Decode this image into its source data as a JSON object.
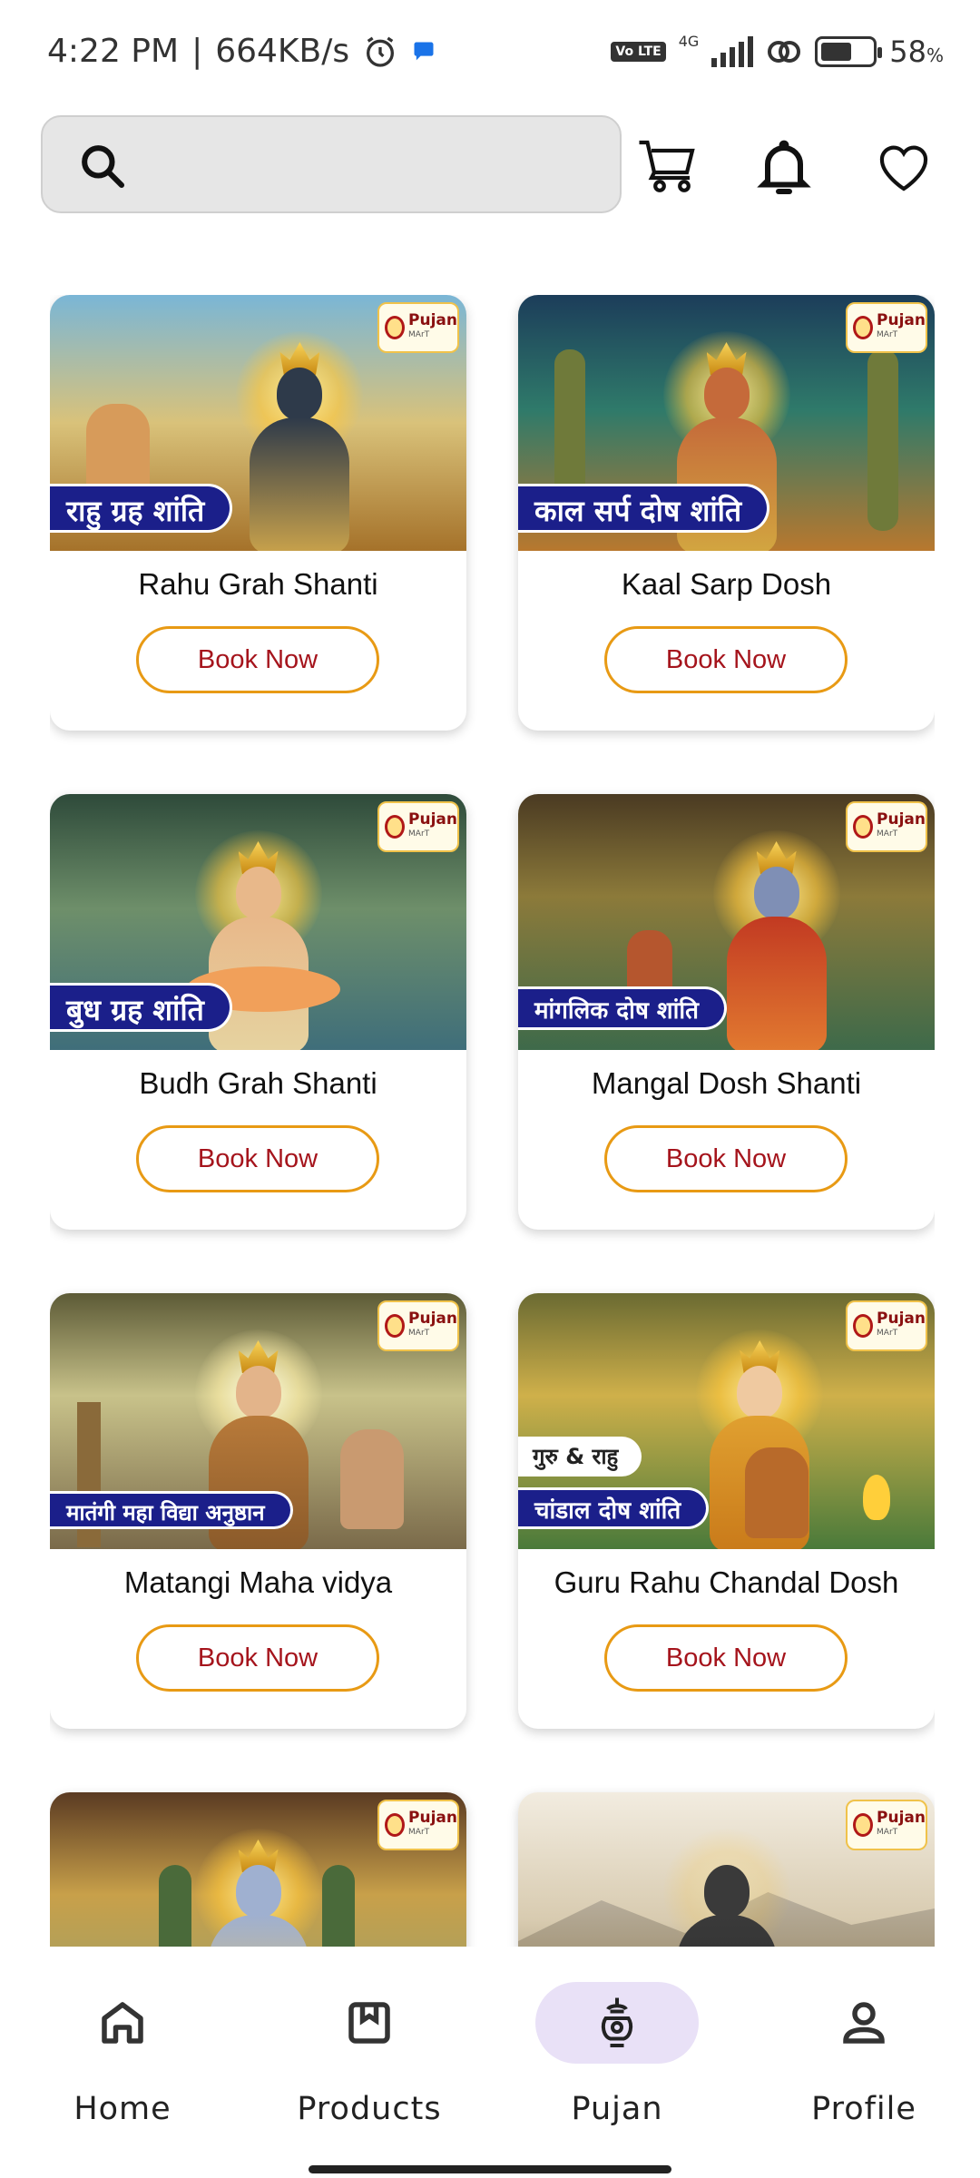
{
  "status_bar": {
    "time": "4:22 PM",
    "separator": "|",
    "speed": "664KB/s",
    "network": "4G",
    "volte": "Vo LTE",
    "battery": "58",
    "battery_unit": "%",
    "battery_level": 0.58
  },
  "header": {
    "search_placeholder": "",
    "cart_icon": "cart-icon",
    "bell_icon": "bell-icon",
    "heart_icon": "heart-icon"
  },
  "logo": {
    "name": "Pujan",
    "tag": "MArT"
  },
  "book_label": "Book Now",
  "cards": [
    {
      "title": "Rahu Grah Shanti",
      "banner": "राहु ग्रह शांति",
      "sub_banner": ""
    },
    {
      "title": "Kaal Sarp Dosh",
      "banner": "काल सर्प दोष शांति",
      "sub_banner": ""
    },
    {
      "title": "Budh Grah Shanti",
      "banner": "बुध ग्रह शांति",
      "sub_banner": ""
    },
    {
      "title": "Mangal Dosh Shanti",
      "banner": "मांगलिक दोष शांति",
      "sub_banner": ""
    },
    {
      "title": "Matangi Maha vidya",
      "banner": "मातंगी महा विद्या अनुष्ठान",
      "sub_banner": ""
    },
    {
      "title": "Guru Rahu Chandal Dosh",
      "banner": "चांडाल दोष शांति",
      "sub_banner": "गुरु & राहु"
    },
    {
      "title": "",
      "banner": "",
      "sub_banner": ""
    },
    {
      "title": "",
      "banner": "",
      "sub_banner": ""
    }
  ],
  "nav": {
    "home": "Home",
    "products": "Products",
    "pujan": "Pujan",
    "profile": "Profile",
    "active": "Pujan"
  },
  "colors": {
    "accent_orange": "#e89a14",
    "book_text": "#a5141c",
    "banner_blue": "#1b1f8a",
    "nav_active": "#e9e1f7"
  }
}
